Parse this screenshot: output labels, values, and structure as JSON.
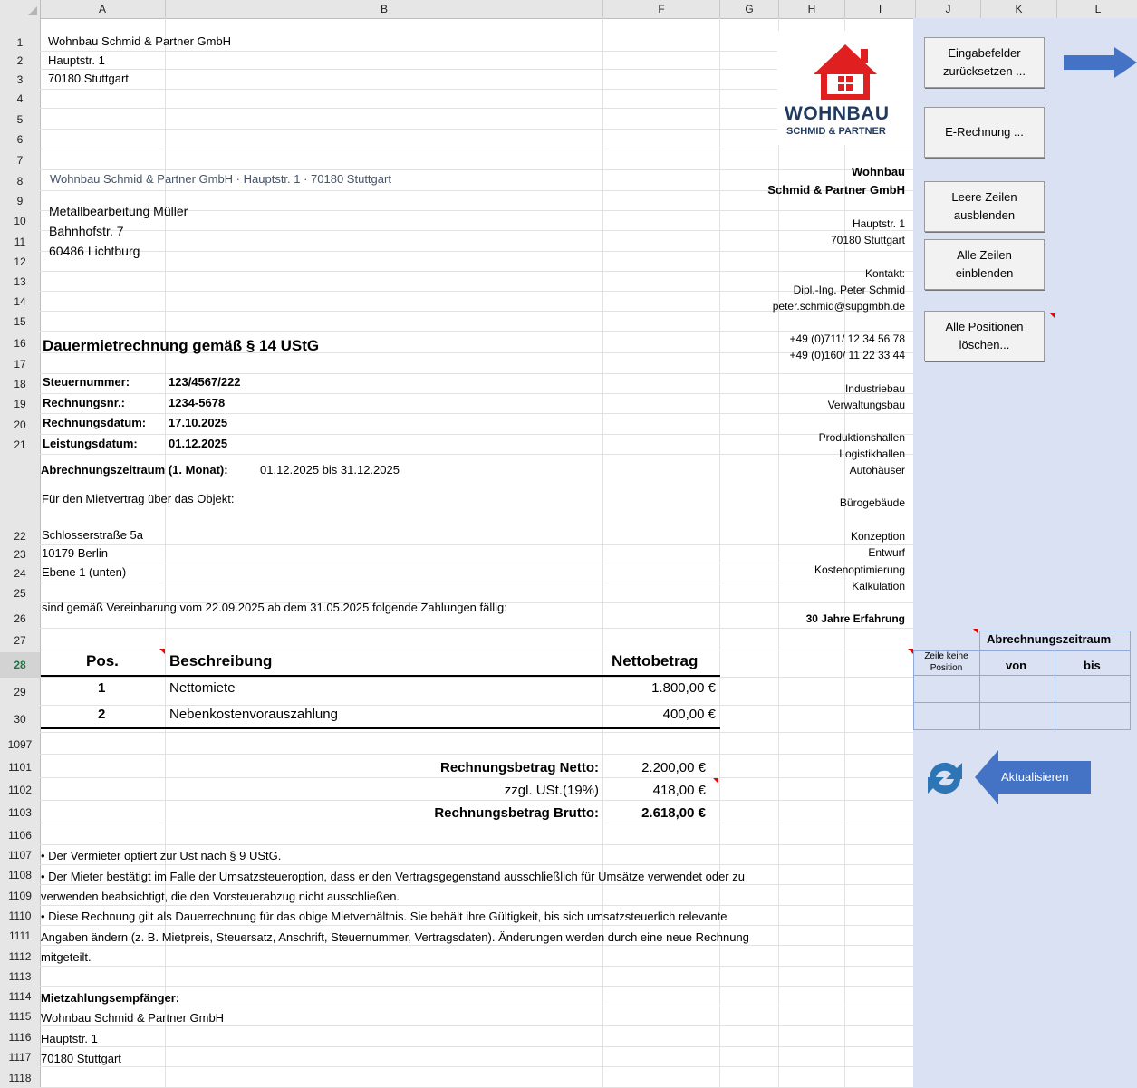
{
  "columns": [
    {
      "label": "A",
      "w": 139
    },
    {
      "label": "B",
      "w": 483
    },
    {
      "label": "F",
      "w": 129
    },
    {
      "label": "G",
      "w": 65
    },
    {
      "label": "H",
      "w": 73
    },
    {
      "label": "I",
      "w": 78
    },
    {
      "label": "J",
      "w": 72
    },
    {
      "label": "K",
      "w": 84
    },
    {
      "label": "L",
      "w": 91
    }
  ],
  "rows": [
    "1",
    "2",
    "3",
    "4",
    "5",
    "6",
    "7",
    "8",
    "9",
    "10",
    "11",
    "12",
    "13",
    "14",
    "15",
    "16",
    "17",
    "18",
    "19",
    "20",
    "21",
    "22",
    "23",
    "24",
    "25",
    "26",
    "27",
    "28",
    "29",
    "30",
    "1097",
    "1101",
    "1102",
    "1103",
    "1106",
    "1107",
    "1108",
    "1109",
    "1110",
    "1111",
    "1112",
    "1113",
    "1114",
    "1115",
    "1116",
    "1117",
    "1118"
  ],
  "sender": {
    "line1": "Wohnbau Schmid & Partner GmbH",
    "line2": "Hauptstr. 1",
    "line3": "70180 Stuttgart"
  },
  "return_address": "Wohnbau Schmid & Partner GmbH  · Hauptstr. 1  · 70180 Stuttgart",
  "recipient": {
    "line1": "Metallbearbeitung Müller",
    "line2": "Bahnhofstr. 7",
    "line3": "60486 Lichtburg"
  },
  "title": "Dauermietrechnung gemäß § 14 UStG",
  "meta": {
    "steuernummer_label": "Steuernummer:",
    "steuernummer": "123/4567/222",
    "rechnungsnr_label": "Rechnungsnr.:",
    "rechnungsnr": "1234-5678",
    "rechnungsdatum_label": "Rechnungsdatum:",
    "rechnungsdatum": "17.10.2025",
    "leistungsdatum_label": "Leistungsdatum:",
    "leistungsdatum": "01.12.2025",
    "zeitraum_label": "Abrechnungszeitraum (1. Monat):",
    "zeitraum": "01.12.2025 bis 31.12.2025"
  },
  "object_intro": "Für den Mietvertrag über das Objekt:",
  "object": {
    "line1": "Schlosserstraße 5a",
    "line2": "10179 Berlin",
    "line3": "Ebene 1 (unten)"
  },
  "agreement": "sind gemäß Vereinbarung vom 22.09.2025 ab dem 31.05.2025 folgende Zahlungen fällig:",
  "table": {
    "headers": {
      "pos": "Pos.",
      "desc": "Beschreibung",
      "amount": "Nettobetrag"
    },
    "items": [
      {
        "pos": "1",
        "desc": "Nettomiete",
        "amount": "1.800,00 €"
      },
      {
        "pos": "2",
        "desc": "Nebenkostenvorauszahlung",
        "amount": "400,00 €"
      }
    ]
  },
  "totals": {
    "netto_label": "Rechnungsbetrag Netto:",
    "netto": "2.200,00 €",
    "ust_label": "zzgl. USt.(19%)",
    "ust": "418,00 €",
    "brutto_label": "Rechnungsbetrag Brutto:",
    "brutto": "2.618,00 €"
  },
  "notes": [
    "• Der Vermieter optiert zur Ust nach § 9 UStG.",
    "• Der Mieter bestätigt im Falle der Umsatzsteueroption, dass er den Vertragsgegenstand ausschließlich für Umsätze verwendet oder zu",
    "verwenden beabsichtigt, die den Vorsteuerabzug nicht ausschließen.",
    "• Diese Rechnung gilt als Dauerrechnung für das obige Mietverhältnis. Sie behält ihre Gültigkeit, bis sich umsatzsteuerlich relevante",
    "Angaben ändern (z. B. Mietpreis, Steuersatz, Anschrift, Steuernummer, Vertragsdaten). Änderungen werden durch eine neue Rechnung",
    "mitgeteilt."
  ],
  "recipient_payment": {
    "label": "Mietzahlungsempfänger:",
    "line1": "Wohnbau Schmid & Partner GmbH",
    "line2": "Hauptstr. 1",
    "line3": "70180 Stuttgart"
  },
  "logo": {
    "brand": "WOHNBAU",
    "sub": "SCHMID & PARTNER",
    "color": "#e02020",
    "text_color": "#1f3a5f"
  },
  "sidebar": {
    "company1": "Wohnbau",
    "company2": "Schmid & Partner GmbH",
    "addr1": "Hauptstr. 1",
    "addr2": "70180 Stuttgart",
    "kontakt": "Kontakt:",
    "person": "Dipl.-Ing. Peter Schmid",
    "email": "peter.schmid@supgmbh.de",
    "tel1": "+49 (0)711/ 12 34 56 78",
    "tel2": "+49 (0)160/ 11 22 33 44",
    "s1": "Industriebau",
    "s2": "Verwaltungsbau",
    "s3": "Produktionshallen",
    "s4": "Logistikhallen",
    "s5": "Autohäuser",
    "s6": "Bürogebäude",
    "s7": "Konzeption",
    "s8": "Entwurf",
    "s9": "Kostenoptimierung",
    "s10": "Kalkulation",
    "exp": "30 Jahre Erfahrung"
  },
  "buttons": {
    "reset": "Eingabefelder\nzurücksetzen ...",
    "erechnung": "E-Rechnung ...",
    "hide": "Leere Zeilen\nausblenden",
    "show": "Alle Zeilen\neinblenden",
    "delete": "Alle Positionen\nlöschen...",
    "refresh": "Aktualisieren"
  },
  "period_table": {
    "header": "Abrechnungszeitraum",
    "no_pos": "Zeile keine\nPosition",
    "von": "von",
    "bis": "bis"
  },
  "colors": {
    "panel": "#d9e1f2",
    "arrow": "#4472c4",
    "header_bg": "#e6e6e6"
  }
}
